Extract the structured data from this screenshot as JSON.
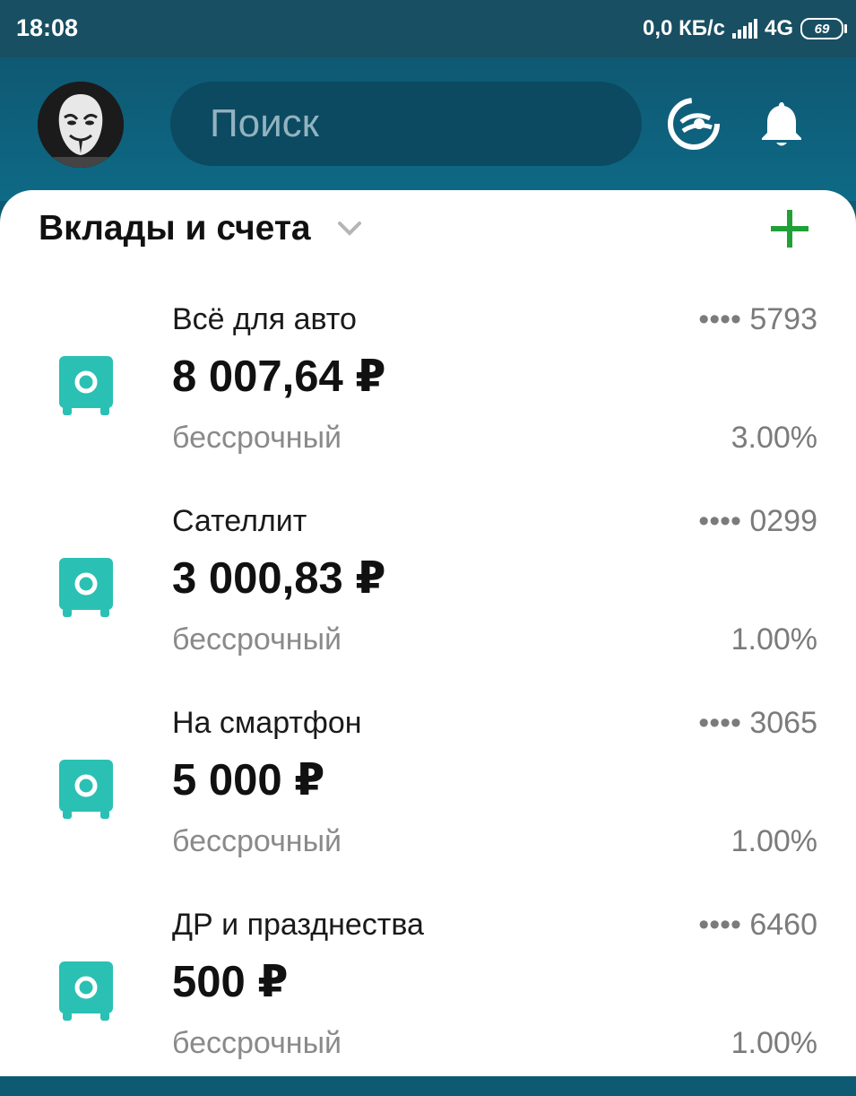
{
  "status_bar": {
    "time": "18:08",
    "speed": "0,0 КБ/с",
    "network": "4G",
    "battery": "69"
  },
  "header": {
    "search_placeholder": "Поиск",
    "avatar_icon": "mask-avatar",
    "brand_icon": "bank-logo-icon",
    "notification_icon": "bell-icon"
  },
  "section": {
    "title": "Вклады и счета"
  },
  "accounts": [
    {
      "name": "Всё для авто",
      "number": "•••• 5793",
      "amount": "8 007,64 ₽",
      "term": "бессрочный",
      "rate": "3.00%"
    },
    {
      "name": "Сателлит",
      "number": "•••• 0299",
      "amount": "3 000,83 ₽",
      "term": "бессрочный",
      "rate": "1.00%"
    },
    {
      "name": "На смартфон",
      "number": "•••• 3065",
      "amount": "5 000 ₽",
      "term": "бессрочный",
      "rate": "1.00%"
    },
    {
      "name": "ДР и празднества",
      "number": "•••• 6460",
      "amount": "500 ₽",
      "term": "бессрочный",
      "rate": "1.00%"
    }
  ],
  "colors": {
    "header": "#0e6a86",
    "accent_green": "#21a038",
    "safe_icon": "#2bc0b4"
  }
}
